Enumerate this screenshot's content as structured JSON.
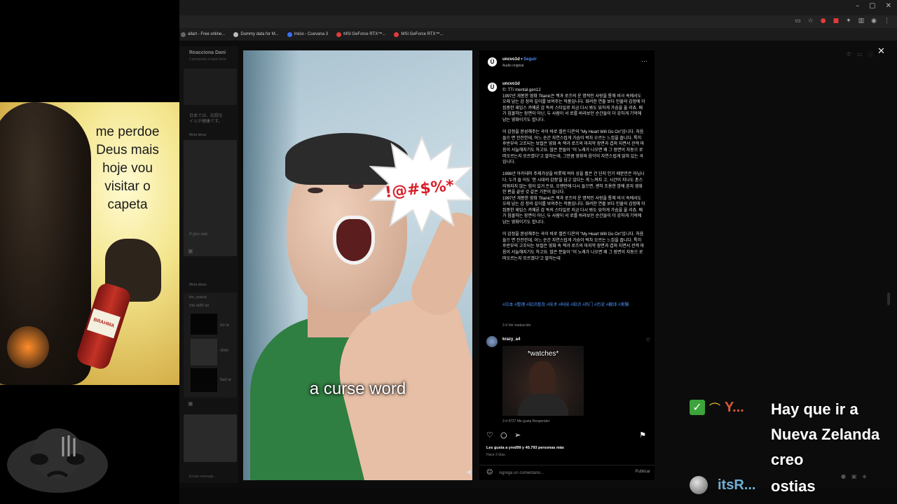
{
  "browser": {
    "window_controls": [
      "–",
      "▢",
      "✕"
    ],
    "bookmarks": [
      {
        "label": "allart - Free online...",
        "color": "#666666"
      },
      {
        "label": "Dummy data for M...",
        "color": "#bbbbbb"
      },
      {
        "label": "Inicio - Cuevana 3",
        "color": "#3a6ff0"
      },
      {
        "label": "MSI GeForce RTX™...",
        "color": "#e23b3b"
      },
      {
        "label": "MSI GeForce RTX™...",
        "color": "#e23b3b"
      }
    ]
  },
  "background_page": {
    "header": "Reacciona Dani",
    "subheader": "2 personas a hace hora",
    "snippet1": "日本では、記録を",
    "snippet2": "イルが健康です。",
    "label1": "Meta ideas",
    "label2": "Meta ideas",
    "label3": "the_realcat",
    "snippet3": "me with wi",
    "snippet4": "no w",
    "snippet5": "slow",
    "snippet6": "fast w",
    "snippet7": "If you see",
    "input_placeholder": "Enviar mensaje..."
  },
  "video": {
    "burst_text": "!@#$%*",
    "caption": "a curse word"
  },
  "post": {
    "author": "uncvo1d",
    "follow_label": "Seguir",
    "audio": "Audio original",
    "more_icon": "···",
    "caption_author": "uncvo1d",
    "caption_text": "©: TT/ mental.gen12\n1997년 개봉한 영화 Titanic은 잭과 로즈의 운 명적인 사랑을 통해 비극 속에서도 오래 남는 감 정의 깊이를 보여주는 작품입니다. 화려한 연출 보다 인물의 감정에 더 집중한 재임스 카메론 감 독의 스타일로 지금 다시 봐도 묘하게 가슴을 울 리죠. 배가 침몰하는 장면이 아닌, 두 사람이 서 로를 바라보던 순간들이 더 강하게 기억에 남는 영화이기도 합니다.\n\n이 감정을 완성해주는 곡이 바로 셀린 디온의 \"My Heart Will Go On\"입니다. 처음 들으 면 잔잔한데, 어느 순간 자연스럽게 가슴이 벅차 오르는 느낌을 줍니다. 특히 후반부의 고조되는 보컬은 영화 속 잭과 로즈의 마지막 장면과 겹쳐 지면서 관객 마음이 서늘해지기도 하고요. 많은 분들이 \"이 노래가 나오면 왜 그 장면이 자동으 로 떠오르는지 모르겠다\"고 말하는데, 그만큼 영화와 음악이 자연스럽게 얽혀 있는 곡입니다.\n\n1998년 아카데미 주제가상을 비롯해 여러 상을 휩쓴 건 단지 인기 때문만은 아닙니다. 누가 들 어도 '한 시대의 감정'을 담고 있다는 게 느껴지 고, 시간이 지나도 촌스러워지지 않는 힘이 있거 든요. 오랜만에 다시 들으면, 괜히 조용한 밤에 혼자 영화 한 편을 끝낸 것 같은 기분이 듭니다.\n1997년 개봉한 영화 Titanic은 잭과 로즈의 운 명적인 사랑을 통해 비극 속에서도 오래 남는 감 정의 깊이를 보여주는 작품입니다. 화려한 연출 보다 인물의 감정에 더 집중한 재임스 카메론 감 독의 스타일로 지금 다시 봐도 묘하게 가슴을 울 리죠. 배가 침몰하는 장면이 아닌, 두 사람이 서 로를 바라보던 순간들이 더 강하게 기억에 남는 영화이기도 합니다.\n\n이 감정을 완성해주는 곡이 바로 셀린 디온의 \"My Heart Will Go On\"입니다. 처음 들으 면 잔잔한데, 어느 순간 자연스럽게 가슴이 벅차 오르는 느낌을 줍니다. 특히 후반부의 고조되는 보컬은 영화 속 잭과 로즈의 마지막 장면과 겹쳐 지면서 관객 마음이 서늘해지기도 하고요. 많은 분들이 \"이 노래가 나오면 왜 그 장면이 자동으 로 떠오르는지 모르겠다\"고 말하는데",
    "hashtags": "#日本 #整理 #知识普及 #技术 #科技 #知识 #热门 #历史 #翻译 #実験",
    "caption_meta": "3 d   Ver traducción",
    "comment_author": "krazy_a4",
    "gif_text": "*watches*",
    "comment_meta": "3 d   4727 Me gusta   Responder",
    "likes_text": "Les gusta a yred99 y 40.793 personas más",
    "ago": "Hace 3 días",
    "comment_placeholder": "Agrega un comentario...",
    "publish_label": "Publicar"
  },
  "meme": {
    "text": "me perdoe\nDeus mais\nhoje vou\nvisitar o\ncapeta",
    "bottle_label": "BRAHMA"
  },
  "chat": {
    "user1": "Y...",
    "user2": "itsR...",
    "msg1": "Hay que ir a",
    "msg2": "Nueva Zelanda",
    "msg3": "creo",
    "msg4": "ostias"
  },
  "colors": {
    "accent_link": "#4a8ff7",
    "chat_user1": "#d9583a",
    "chat_user2": "#6fb0d6",
    "check_badge": "#3ca43a"
  }
}
